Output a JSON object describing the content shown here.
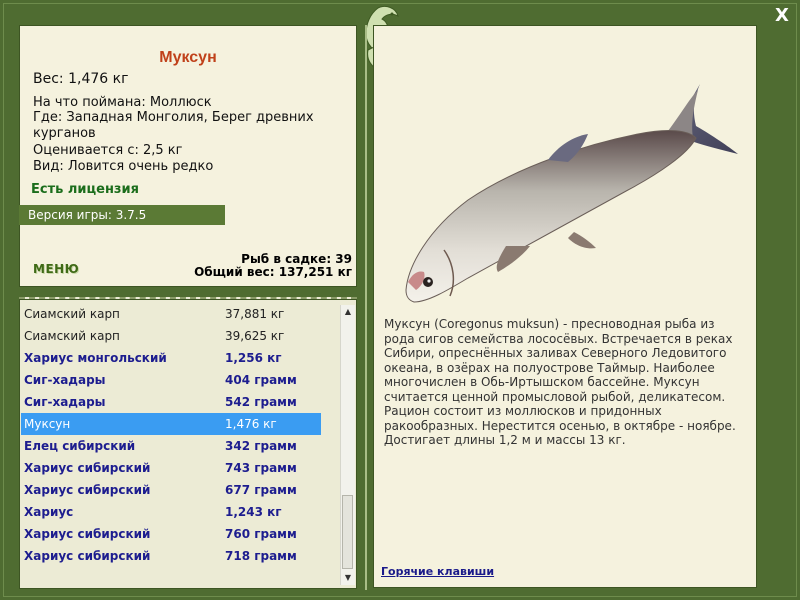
{
  "header": {
    "close_label": "X"
  },
  "fish": {
    "title": "Муксун",
    "weight": "Вес: 1,476 кг",
    "caught_on": "На что поймана: Моллюск",
    "where": "Где: Западная Монголия, Берег древних курганов",
    "price": "Оценивается с: 2,5 кг",
    "kind": "Вид: Ловится очень редко",
    "license": "Есть лицензия",
    "description": "Муксун (Coregonus muksun) - пресноводная рыба из рода сигов семейства лососёвых. Встречается в реках Сибири, опреснённых заливах Северного Ледовитого океана, в озёрах на полуострове Таймыр. Наиболее многочислен в Обь-Иртышском бассейне. Муксун считается ценной промысловой рыбой, деликатесом. Рацион состоит из моллюсков и придонных ракообразных. Нерестится осенью, в октябре - ноябре. Достигает длины 1,2 м и массы 13 кг."
  },
  "game": {
    "version": "Версия игры: 3.7.5"
  },
  "menu": {
    "label": "МЕНЮ"
  },
  "keep": {
    "count_text": "Рыб в садке: 39",
    "total_text": "Общий вес: 137,251 кг"
  },
  "catch_list": [
    {
      "name": "Сиамский карп",
      "weight": "37,881 кг",
      "style": "norm"
    },
    {
      "name": "Сиамский карп",
      "weight": "39,625 кг",
      "style": "norm"
    },
    {
      "name": "Хариус монгольский",
      "weight": "1,256 кг",
      "style": "bold"
    },
    {
      "name": "Сиг-хадары",
      "weight": "404 грамм",
      "style": "bold"
    },
    {
      "name": "Сиг-хадары",
      "weight": "542 грамм",
      "style": "bold"
    },
    {
      "name": "Муксун",
      "weight": "1,476 кг",
      "style": "sel"
    },
    {
      "name": "Елец сибирский",
      "weight": "342 грамм",
      "style": "bold"
    },
    {
      "name": "Хариус сибирский",
      "weight": "743 грамм",
      "style": "bold"
    },
    {
      "name": "Хариус сибирский",
      "weight": "677 грамм",
      "style": "bold"
    },
    {
      "name": "Хариус",
      "weight": "1,243 кг",
      "style": "bold"
    },
    {
      "name": "Хариус сибирский",
      "weight": "760 грамм",
      "style": "bold"
    },
    {
      "name": "Хариус сибирский",
      "weight": "718 грамм",
      "style": "bold"
    }
  ],
  "links": {
    "hotkeys": "Горячие клавиши"
  },
  "colors": {
    "frame": "#4f6c31",
    "panel": "#f5f2de",
    "title": "#c0411a",
    "selected": "#3a9cf2",
    "bold_row": "#1d1d8f"
  }
}
